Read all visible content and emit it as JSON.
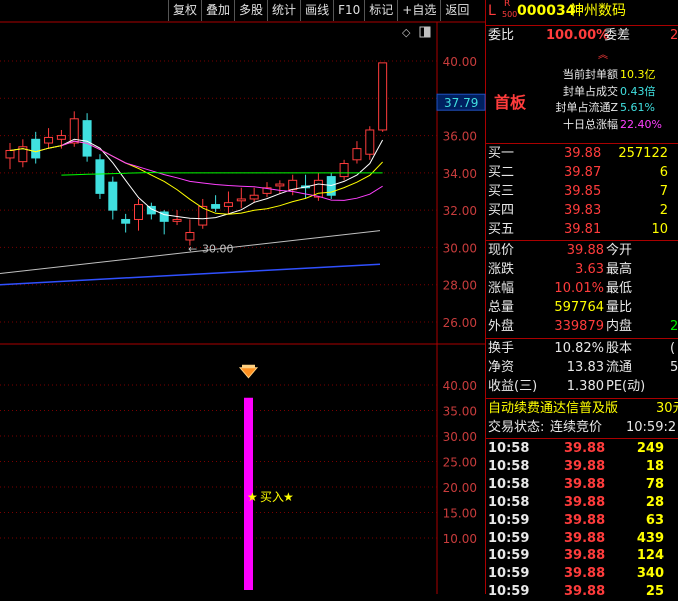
{
  "toolbar": [
    {
      "id": "fuquan",
      "label": "复权"
    },
    {
      "id": "diejia",
      "label": "叠加"
    },
    {
      "id": "duogu",
      "label": "多股"
    },
    {
      "id": "tongji",
      "label": "统计"
    },
    {
      "id": "huaxian",
      "label": "画线"
    },
    {
      "id": "f10",
      "label": "F10"
    },
    {
      "id": "biaoji",
      "label": "标记"
    },
    {
      "id": "zixuan",
      "label": "+自选"
    },
    {
      "id": "fanhui",
      "label": "返回"
    }
  ],
  "stock": {
    "flag_l": "L",
    "flag_r": "R",
    "flag_num": "500",
    "code": "000034",
    "name": "神州数码"
  },
  "weibi": {
    "label": "委比",
    "value": "100.00%",
    "label2": "委差",
    "value2": "2"
  },
  "seal": {
    "badge": "首板",
    "lines": [
      {
        "label": "当前封单额",
        "value": "10.3亿"
      },
      {
        "label": "封单占成交",
        "value": "0.43倍"
      },
      {
        "label": "封单占流通Z",
        "value": "5.61%"
      },
      {
        "label": "十日总涨幅",
        "value": "22.40%"
      }
    ]
  },
  "bids": [
    {
      "label": "买一",
      "price": "39.88",
      "vol": "257122"
    },
    {
      "label": "买二",
      "price": "39.87",
      "vol": "6"
    },
    {
      "label": "买三",
      "price": "39.85",
      "vol": "7"
    },
    {
      "label": "买四",
      "price": "39.83",
      "vol": "2"
    },
    {
      "label": "买五",
      "price": "39.81",
      "vol": "10"
    }
  ],
  "quote": [
    {
      "l1": "现价",
      "v1": "39.88",
      "l2": "今开",
      "v2": ""
    },
    {
      "l1": "涨跌",
      "v1": "3.63",
      "l2": "最高",
      "v2": ""
    },
    {
      "l1": "涨幅",
      "v1": "10.01%",
      "l2": "最低",
      "v2": ""
    },
    {
      "l1": "总量",
      "v1": "597764",
      "l2": "量比",
      "v2": ""
    },
    {
      "l1": "外盘",
      "v1": "339879",
      "l2": "内盘",
      "v2": "2"
    }
  ],
  "stats": [
    {
      "l1": "换手",
      "v1": "10.82%",
      "l2": "股本",
      "v2": "("
    },
    {
      "l1": "净资",
      "v1": "13.83",
      "l2": "流通",
      "v2": "5"
    },
    {
      "l1": "收益(三)",
      "v1": "1.380",
      "l2": "PE(动)",
      "v2": ""
    }
  ],
  "marquee": {
    "text": "自动续费通达信普及版",
    "price": "30元"
  },
  "trade_status": {
    "label": "交易状态:",
    "value": "连续竞价",
    "time": "10:59:2"
  },
  "ticks": [
    {
      "time": "10:58",
      "price": "39.88",
      "vol": "249"
    },
    {
      "time": "10:58",
      "price": "39.88",
      "vol": "18"
    },
    {
      "time": "10:58",
      "price": "39.88",
      "vol": "78"
    },
    {
      "time": "10:58",
      "price": "39.88",
      "vol": "28"
    },
    {
      "time": "10:59",
      "price": "39.88",
      "vol": "63"
    },
    {
      "time": "10:59",
      "price": "39.88",
      "vol": "439"
    },
    {
      "time": "10:59",
      "price": "39.88",
      "vol": "124"
    },
    {
      "time": "10:59",
      "price": "39.88",
      "vol": "340"
    },
    {
      "time": "10:59",
      "price": "39.88",
      "vol": "25"
    }
  ],
  "main_chart": {
    "y_ticks": [
      "40.00",
      "38.00",
      "36.00",
      "34.00",
      "32.00",
      "30.00",
      "28.00",
      "26.00"
    ],
    "current_price": "37.79",
    "low_marker": "30.00",
    "candles": [
      {
        "o": 34.8,
        "c": 35.2,
        "h": 35.6,
        "l": 34.2
      },
      {
        "o": 34.6,
        "c": 35.4,
        "h": 35.8,
        "l": 34.3
      },
      {
        "o": 35.8,
        "c": 34.8,
        "h": 36.2,
        "l": 34.5
      },
      {
        "o": 35.6,
        "c": 35.9,
        "h": 36.4,
        "l": 35.3
      },
      {
        "o": 35.8,
        "c": 36.0,
        "h": 36.3,
        "l": 35.3
      },
      {
        "o": 35.6,
        "c": 36.9,
        "h": 37.3,
        "l": 35.4
      },
      {
        "o": 36.8,
        "c": 34.9,
        "h": 37.2,
        "l": 34.6
      },
      {
        "o": 34.7,
        "c": 32.9,
        "h": 35.0,
        "l": 32.6
      },
      {
        "o": 33.5,
        "c": 32.0,
        "h": 33.8,
        "l": 31.5
      },
      {
        "o": 31.5,
        "c": 31.3,
        "h": 31.8,
        "l": 30.8
      },
      {
        "o": 31.5,
        "c": 32.3,
        "h": 32.6,
        "l": 30.9
      },
      {
        "o": 32.2,
        "c": 31.8,
        "h": 32.4,
        "l": 31.5
      },
      {
        "o": 31.9,
        "c": 31.4,
        "h": 32.0,
        "l": 30.7
      },
      {
        "o": 31.4,
        "c": 31.5,
        "h": 32.0,
        "l": 31.2
      },
      {
        "o": 30.4,
        "c": 30.8,
        "h": 31.5,
        "l": 30.1
      },
      {
        "o": 31.2,
        "c": 32.2,
        "h": 32.6,
        "l": 31.0
      },
      {
        "o": 32.3,
        "c": 32.1,
        "h": 32.8,
        "l": 31.9
      },
      {
        "o": 32.2,
        "c": 32.4,
        "h": 33.0,
        "l": 31.8
      },
      {
        "o": 32.5,
        "c": 32.6,
        "h": 33.2,
        "l": 32.1
      },
      {
        "o": 32.6,
        "c": 32.8,
        "h": 33.2,
        "l": 32.4
      },
      {
        "o": 32.9,
        "c": 33.2,
        "h": 33.5,
        "l": 32.7
      },
      {
        "o": 33.3,
        "c": 33.4,
        "h": 33.6,
        "l": 32.9
      },
      {
        "o": 33.1,
        "c": 33.6,
        "h": 33.9,
        "l": 32.8
      },
      {
        "o": 33.3,
        "c": 33.2,
        "h": 33.9,
        "l": 32.6
      },
      {
        "o": 32.7,
        "c": 33.6,
        "h": 34.0,
        "l": 32.5
      },
      {
        "o": 33.8,
        "c": 32.8,
        "h": 34.0,
        "l": 32.6
      },
      {
        "o": 33.8,
        "c": 34.5,
        "h": 34.7,
        "l": 33.6
      },
      {
        "o": 34.7,
        "c": 35.3,
        "h": 35.7,
        "l": 34.5
      },
      {
        "o": 35.0,
        "c": 36.3,
        "h": 36.5,
        "l": 34.7
      },
      {
        "o": 36.3,
        "c": 39.9,
        "h": 39.9,
        "l": 36.2
      }
    ]
  },
  "sub_chart": {
    "y_ticks": [
      "40.00",
      "35.00",
      "30.00",
      "25.00",
      "20.00",
      "15.00",
      "10.00"
    ],
    "signal_label": "买入",
    "signal_value": 37.5
  },
  "colors": {
    "up": "#ff3c3c",
    "down": "#40e0e0",
    "ma5": "#ffffff",
    "ma10": "#ffff00",
    "ma20": "#ff40ff",
    "ma30": "#00ff00",
    "ma60": "#c0c0c0",
    "ma120": "#3050ff",
    "bar": "#ff00ff"
  }
}
